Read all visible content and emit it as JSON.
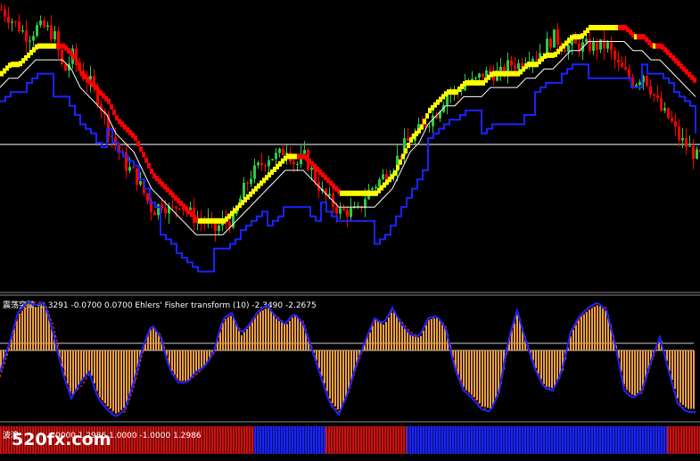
{
  "indicator_header": {
    "text": "震荡突破 -0.3291 -0.0700 0.0700  Ehlers' Fisher transform (10) -2.3490 -2.2675"
  },
  "bottom_pane_label": "波浪",
  "bottom_pane_values": "0000 1.2986 1.0000 -1.0000 1.2986",
  "watermark": "520fx.com",
  "colors": {
    "background": "#000000",
    "bull_candle": "#2ecc40",
    "bear_candle": "#ff0000",
    "mid_line": "#ffffff",
    "trend_red": "#ff0000",
    "trend_yellow": "#ffff00",
    "channel_line": "#1a24ff",
    "smooth_line": "#ffffff",
    "histogram": "#f0a040",
    "fisher_line": "#1a24ff",
    "fisher_signal": "#ff3030",
    "bar_red": "#cc1111",
    "bar_blue": "#1a24ff"
  },
  "chart_data": [
    {
      "type": "line",
      "name": "price",
      "x": [
        0,
        10,
        20,
        30,
        40,
        50,
        60,
        70,
        80,
        90,
        100,
        110,
        120,
        130,
        140,
        150,
        160,
        170,
        180,
        190,
        200,
        210,
        220,
        230,
        240,
        250,
        260,
        270,
        280,
        290,
        300,
        310,
        320,
        330,
        340,
        350,
        360,
        370,
        380,
        390,
        400,
        410,
        420,
        430,
        440,
        450,
        460,
        470,
        480,
        490,
        500,
        510,
        520,
        530,
        540,
        550,
        560,
        570,
        580,
        590,
        600,
        610,
        620,
        630,
        640,
        650,
        660,
        670,
        680,
        690,
        700,
        710,
        720,
        730,
        740,
        750,
        760,
        770,
        780
      ],
      "series": [
        {
          "values": [
            100,
            99,
            98,
            97,
            98,
            98,
            97,
            93,
            95,
            93,
            92,
            90,
            87,
            85,
            83,
            82,
            80,
            78,
            79,
            78,
            79,
            78,
            77,
            77,
            76,
            77,
            77,
            80,
            82,
            83,
            84,
            84,
            85,
            83,
            84,
            82,
            80,
            79,
            78,
            78,
            78,
            80,
            81,
            82,
            83,
            85,
            86,
            87,
            88,
            89,
            91,
            91,
            92,
            92,
            93,
            93,
            93,
            94,
            94,
            95,
            95,
            96,
            97,
            96,
            96,
            96,
            96,
            96,
            96,
            94,
            93,
            92,
            93,
            91,
            89,
            88,
            86,
            85,
            84
          ]
        },
        {
          "values": [
            93,
            94,
            94,
            95,
            96,
            96,
            96,
            96,
            95,
            93,
            92,
            91,
            90,
            88,
            87,
            86,
            84,
            82,
            81,
            80,
            79,
            78,
            77,
            77,
            77,
            77,
            78,
            79,
            80,
            81,
            82,
            83,
            84,
            84,
            84,
            83,
            82,
            81,
            80,
            80,
            80,
            80,
            80,
            81,
            82,
            84,
            86,
            87,
            89,
            90,
            91,
            91,
            92,
            92,
            92,
            93,
            93,
            93,
            93,
            94,
            94,
            95,
            95,
            96,
            97,
            97,
            98,
            98,
            98,
            98,
            98,
            97,
            97,
            96,
            96,
            95,
            94,
            93,
            92
          ]
        }
      ]
    },
    {
      "type": "line",
      "name": "fisher",
      "x": [
        0,
        10,
        20,
        30,
        40,
        50,
        60,
        70,
        80,
        90,
        100,
        110,
        120,
        130,
        140,
        150,
        160,
        170,
        180,
        190,
        200,
        210,
        220,
        230,
        240,
        250,
        260,
        270,
        280,
        290,
        300,
        310,
        320,
        330,
        340,
        350,
        360,
        370,
        380,
        390,
        400,
        410,
        420,
        430,
        440,
        450,
        460,
        470,
        480,
        490,
        500,
        510,
        520,
        530,
        540,
        550,
        560,
        570,
        580,
        590,
        600,
        610,
        620,
        630,
        640,
        650,
        660,
        670,
        680,
        690,
        700,
        710,
        720,
        730,
        740,
        750,
        760,
        770,
        780
      ],
      "series": [
        {
          "values": [
            -0.8,
            0.2,
            1.4,
            1.8,
            1.7,
            1.8,
            0.6,
            -0.8,
            -1.8,
            -1.2,
            -0.8,
            -1.8,
            -2.2,
            -2.5,
            -2.2,
            -1.2,
            0.1,
            1.0,
            0.5,
            -0.7,
            -1.2,
            -1.2,
            -0.8,
            -0.6,
            0.0,
            1.2,
            1.4,
            0.6,
            1.0,
            1.5,
            1.7,
            1.2,
            1.0,
            1.4,
            1.0,
            0.0,
            -1.0,
            -2.0,
            -2.4,
            -1.6,
            -0.5,
            0.4,
            1.2,
            1.0,
            1.6,
            1.0,
            0.6,
            0.5,
            1.2,
            1.3,
            0.8,
            -0.7,
            -1.5,
            -1.8,
            -2.2,
            -2.3,
            -1.5,
            0.4,
            1.5,
            0.3,
            -0.7,
            -1.4,
            -1.5,
            -0.8,
            0.7,
            1.3,
            1.6,
            1.8,
            1.5,
            0.2,
            -1.5,
            -1.8,
            -1.5,
            -0.4,
            0.5,
            -0.8,
            -2.0,
            -2.3,
            -2.3
          ]
        },
        {
          "values": [
            -1.0,
            0.0,
            1.2,
            1.7,
            1.8,
            1.8,
            0.9,
            -0.5,
            -1.6,
            -1.4,
            -0.9,
            -1.6,
            -2.1,
            -2.4,
            -2.3,
            -1.4,
            -0.1,
            0.9,
            0.6,
            -0.5,
            -1.1,
            -1.2,
            -0.9,
            -0.6,
            -0.1,
            1.0,
            1.4,
            0.7,
            0.9,
            1.4,
            1.6,
            1.3,
            1.0,
            1.3,
            1.1,
            0.1,
            -0.9,
            -1.9,
            -2.3,
            -1.7,
            -0.6,
            0.3,
            1.1,
            1.0,
            1.5,
            1.1,
            0.7,
            0.5,
            1.1,
            1.3,
            0.9,
            -0.5,
            -1.4,
            -1.7,
            -2.1,
            -2.3,
            -1.6,
            0.2,
            1.4,
            0.4,
            -0.6,
            -1.3,
            -1.5,
            -0.9,
            0.6,
            1.2,
            1.5,
            1.7,
            1.6,
            0.3,
            -1.3,
            -1.7,
            -1.6,
            -0.5,
            0.4,
            -0.7,
            -1.9,
            -2.3,
            -2.3
          ]
        }
      ]
    }
  ]
}
